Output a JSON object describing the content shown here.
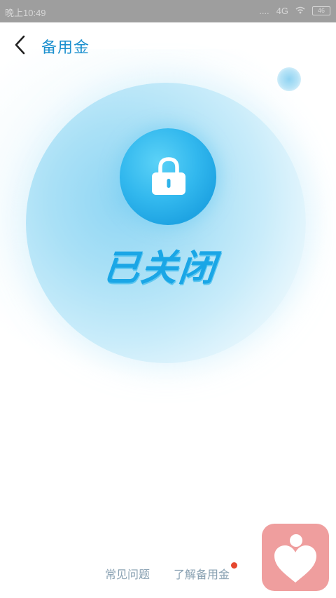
{
  "statusbar": {
    "time": "晚上10:49",
    "signal": "....",
    "network": "4G",
    "battery": "46"
  },
  "header": {
    "title": "备用金"
  },
  "main": {
    "status_text": "已关闭"
  },
  "bottom": {
    "faq_label": "常见问题",
    "learn_label": "了解备用金"
  },
  "colors": {
    "accent": "#1a8fce",
    "status_blue": "#1aa6e6",
    "link_gray": "#8aa2b3",
    "badge_red": "#e5472f",
    "widget_pink": "#ef9e9e"
  },
  "icons": {
    "back": "chevron-left-icon",
    "lock": "lock-icon",
    "floating": "heart-person-icon"
  }
}
